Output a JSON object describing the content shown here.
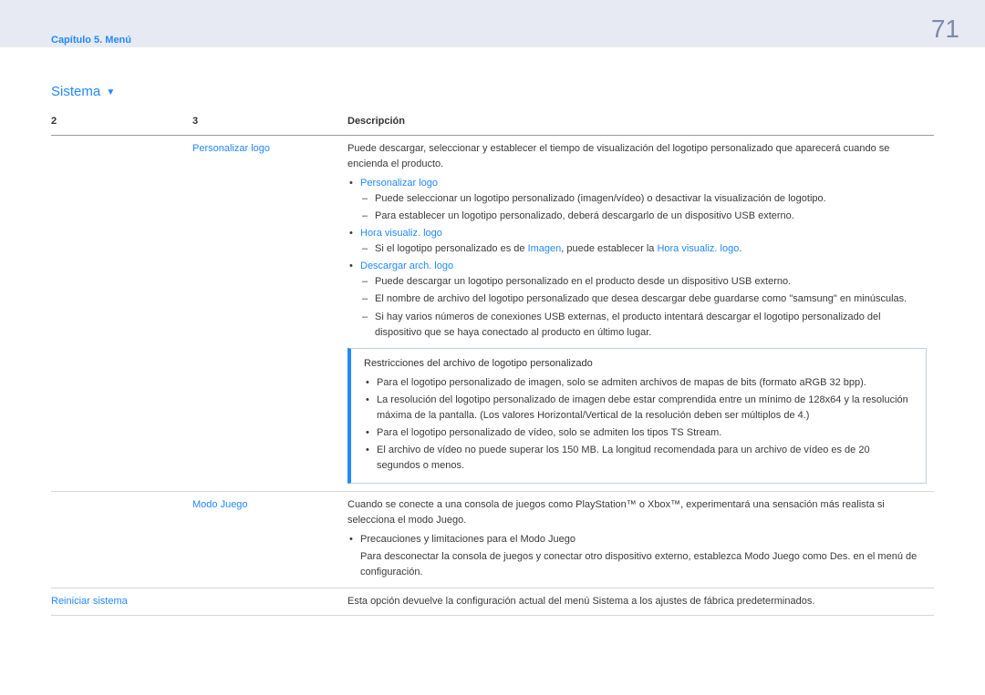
{
  "header": {
    "breadcrumb": "Capítulo 5. Menú",
    "pageNumber": "71"
  },
  "section": {
    "title": "Sistema",
    "triangle": "▼"
  },
  "tableHead": {
    "c2": "2",
    "c3": "3",
    "desc": "Descripción"
  },
  "row1": {
    "col3": "Personalizar logo",
    "intro": "Puede descargar, seleccionar y establecer el tiempo de visualización del logotipo personalizado que aparecerá cuando se encienda el producto.",
    "b1_head": "Personalizar logo",
    "b1_d1": "Puede seleccionar un logotipo personalizado (imagen/vídeo) o desactivar la visualización de logotipo.",
    "b1_d2": "Para establecer un logotipo personalizado, deberá descargarlo de un dispositivo USB externo.",
    "b2_head": "Hora visualiz. logo",
    "b2_d1_pre": "Si el logotipo personalizado es de ",
    "b2_d1_imagen": "Imagen",
    "b2_d1_mid": ", puede establecer la ",
    "b2_d1_hora": "Hora visualiz. logo",
    "b2_d1_suf": ".",
    "b3_head": "Descargar arch. logo",
    "b3_d1": "Puede descargar un logotipo personalizado en el producto desde un dispositivo USB externo.",
    "b3_d2": "El nombre de archivo del logotipo personalizado que desea descargar debe guardarse como \"samsung\" en minúsculas.",
    "b3_d3": "Si hay varios números de conexiones USB externas, el producto intentará descargar el logotipo personalizado del dispositivo que se haya conectado al producto en último lugar.",
    "box_title": "Restricciones del archivo de logotipo personalizado",
    "box_b1": "Para el logotipo personalizado de imagen, solo se admiten archivos de mapas de bits (formato aRGB 32 bpp).",
    "box_b2": "La resolución del logotipo personalizado de imagen debe estar comprendida entre un mínimo de 128x64 y la resolución máxima de la pantalla. (Los valores Horizontal/Vertical de la resolución deben ser múltiplos de 4.)",
    "box_b3": "Para el logotipo personalizado de vídeo, solo se admiten los tipos TS Stream.",
    "box_b4": "El archivo de vídeo no puede superar los 150 MB. La longitud recomendada para un archivo de vídeo es de 20 segundos o menos."
  },
  "row2": {
    "col3": "Modo Juego",
    "intro": "Cuando se conecte a una consola de juegos como PlayStation™ o Xbox™, experimentará una sensación más realista si selecciona el modo Juego.",
    "b1": "Precauciones y limitaciones para el Modo Juego",
    "b1_sub": "Para desconectar la consola de juegos y conectar otro dispositivo externo, establezca Modo Juego como Des. en el menú de configuración."
  },
  "row3": {
    "col2": "Reiniciar sistema",
    "desc": "Esta opción devuelve la configuración actual del menú Sistema a los ajustes de fábrica predeterminados."
  }
}
